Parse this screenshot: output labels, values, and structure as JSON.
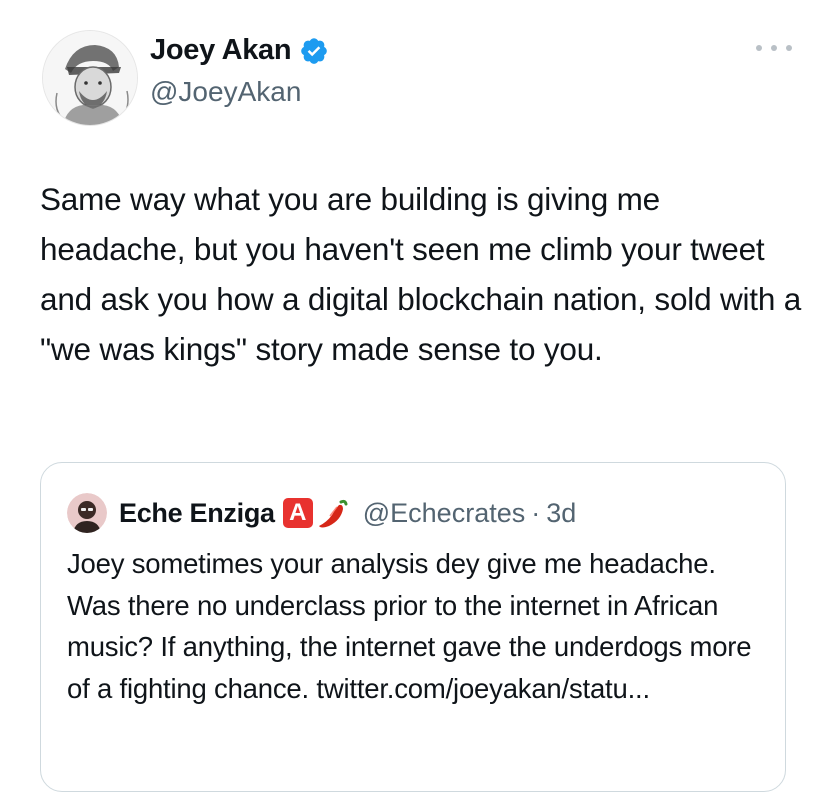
{
  "tweet": {
    "author_name": "Joey Akan",
    "author_handle": "@JoeyAkan",
    "verified_icon": "verified-badge-icon",
    "more_icon": "more-options-icon",
    "text": "Same way what you are building is giving me headache, but you haven't seen me climb your tweet and ask you how a digital blockchain nation, sold with a \"we was kings\" story made sense to you."
  },
  "quoted_tweet": {
    "author_name": "Eche Enziga",
    "badge_letter": "A",
    "emoji_icon": "chili-pepper-icon",
    "author_handle": "@Echecrates",
    "separator": "·",
    "time": "3d",
    "text": "Joey sometimes your analysis dey give me headache. Was there no underclass prior to the internet in African music? If anything, the internet gave the underdogs more of a fighting chance. twitter.com/joeyakan/statu..."
  },
  "colors": {
    "text_primary": "#0f1419",
    "text_secondary": "#536471",
    "verified_blue": "#1d9bf0",
    "border": "#cfd9de",
    "badge_red": "#e8322f"
  }
}
